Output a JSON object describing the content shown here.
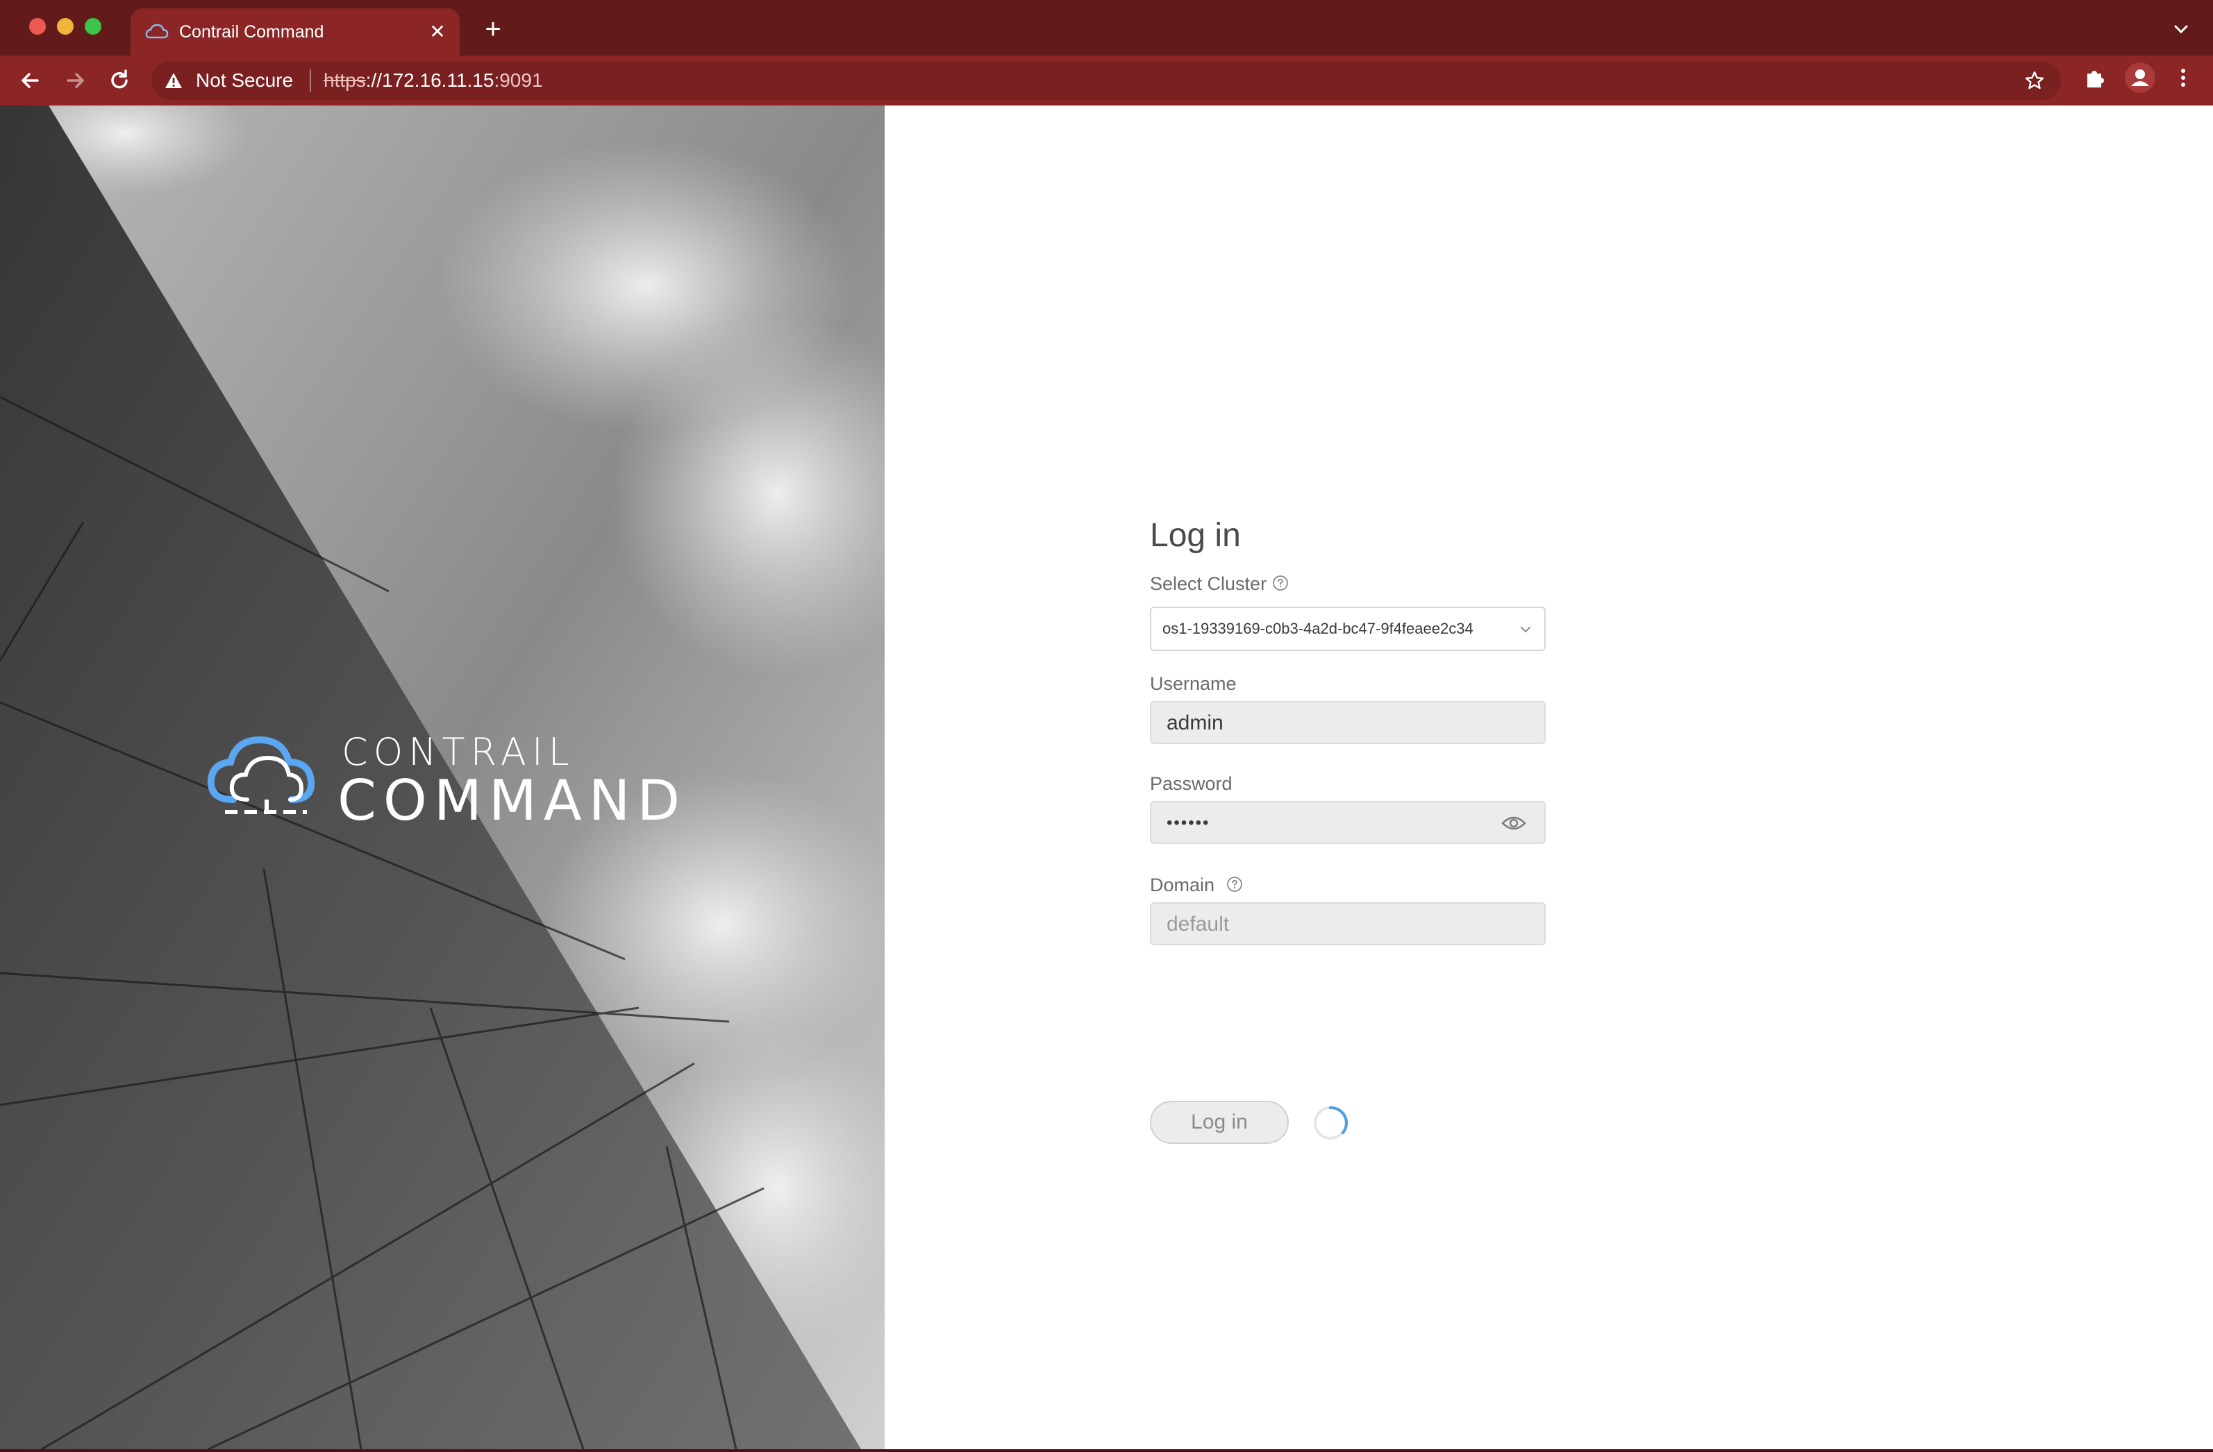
{
  "browser": {
    "tab_title": "Contrail Command",
    "tab_close": "✕",
    "new_tab": "+",
    "security_label": "Not Secure",
    "url_scheme": "https",
    "url_host": "://172.16.11.15",
    "url_port": ":9091",
    "accent_color": "#8c2525",
    "titlebar_color": "#621a1a"
  },
  "brand": {
    "line1": "CONTRAIL",
    "line2": "COMMAND",
    "logo_color": "#5aa6f0"
  },
  "login": {
    "title": "Log in",
    "cluster_label": "Select Cluster",
    "cluster_value": "os1-19339169-c0b3-4a2d-bc47-9f4feaee2c34",
    "username_label": "Username",
    "username_value": "admin",
    "password_label": "Password",
    "password_value": "••••••",
    "domain_label": "Domain",
    "domain_placeholder": "default",
    "submit_label": "Log in",
    "spinner_color": "#4a9fe6"
  }
}
